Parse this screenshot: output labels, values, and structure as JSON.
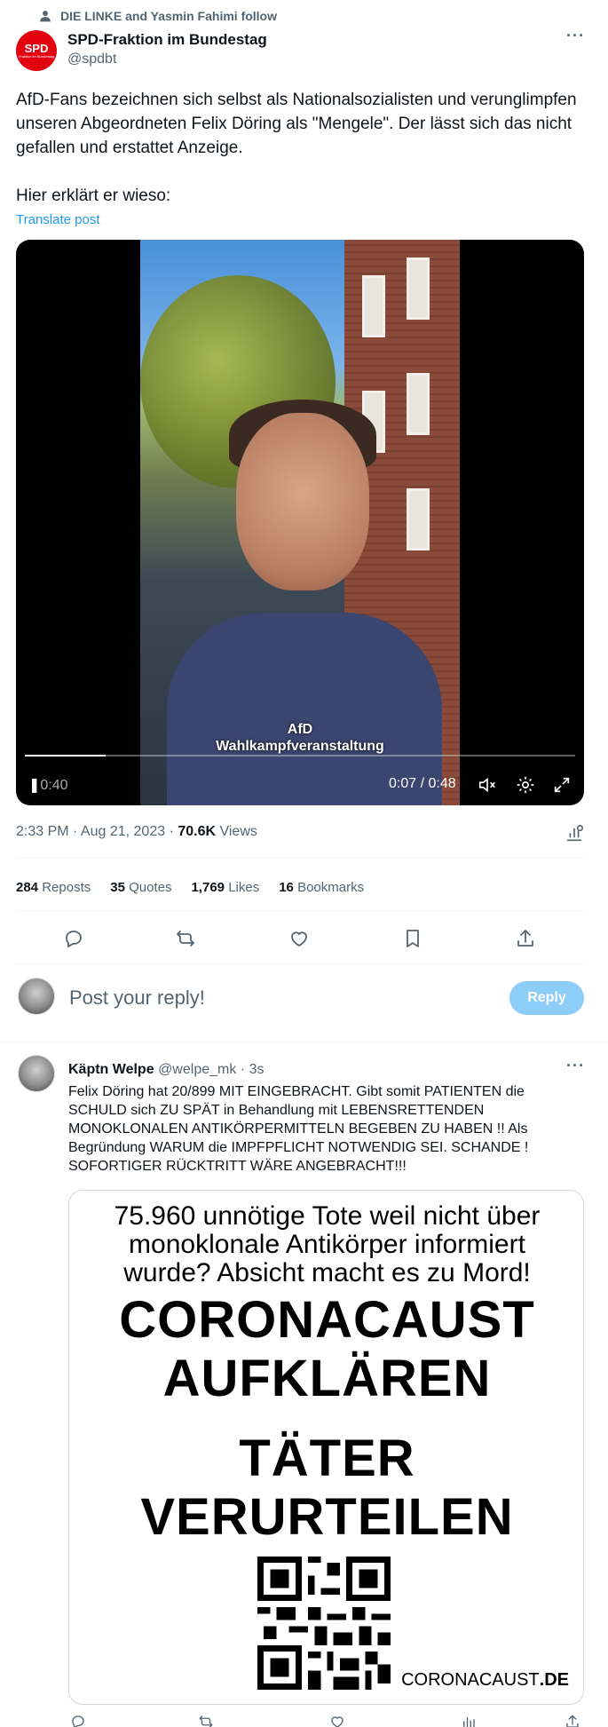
{
  "social_context": "DIE LINKE and Yasmin Fahimi follow",
  "author": {
    "name": "SPD-Fraktion im Bundestag",
    "handle": "@spdbt",
    "avatar_text": "SPD",
    "avatar_subtext": "Fraktion im Bundestag"
  },
  "tweet": {
    "text": "AfD-Fans bezeichnen sich selbst als Nationalsozialisten und verunglimpfen unseren Abgeordneten Felix Döring als \"Mengele\". Der lässt sich das nicht gefallen und erstattet Anzeige.\n\nHier erklärt er wieso:",
    "translate": "Translate post"
  },
  "video": {
    "caption_line1": "AfD",
    "caption_line2": "Wahlkampfveranstaltung",
    "left_time": "0:40",
    "time": "0:07 / 0:48",
    "progress": 0.146
  },
  "meta": {
    "time": "2:33 PM · Aug 21, 2023 · ",
    "views_count": "70.6K",
    "views_label": " Views"
  },
  "stats": {
    "reposts_count": "284",
    "reposts_label": "Reposts",
    "quotes_count": "35",
    "quotes_label": "Quotes",
    "likes_count": "1,769",
    "likes_label": "Likes",
    "bookmarks_count": "16",
    "bookmarks_label": "Bookmarks"
  },
  "compose": {
    "placeholder": "Post your reply!",
    "button": "Reply"
  },
  "reply": {
    "name": "Käptn Welpe",
    "handle": "@welpe_mk",
    "time": "· 3s",
    "text": "Felix Döring hat 20/899 MIT EINGEBRACHT. Gibt somit PATIENTEN die SCHULD sich ZU SPÄT in Behandlung mit LEBENSRETTENDEN MONOKLONALEN ANTIKÖRPERMITTELN BEGEBEN ZU HABEN !! Als Begründung WARUM die IMPFPFLICHT NOTWENDIG SEI. SCHANDE ! SOFORTIGER RÜCKTRITT WÄRE ANGEBRACHT!!!",
    "poster": {
      "line1": "75.960 unnötige Tote weil nicht über",
      "line2": "monoklonale Antikörper informiert",
      "line3": "wurde? Absicht macht es zu Mord!",
      "big1": "CORONACAUST",
      "big2": "AUFKLÄREN",
      "big3": "TÄTER",
      "big4": "VERURTEILEN",
      "site_main": "CORONACAUST",
      "site_tld": ".DE"
    }
  },
  "colors": {
    "accent": "#1d9bf0",
    "reply_button": "#8ecdf8",
    "spd_red": "#e3000f",
    "muted": "#536471"
  },
  "icons": [
    "person-icon",
    "more-icon",
    "mute-icon",
    "settings-icon",
    "fullscreen-icon",
    "reply-icon",
    "repost-icon",
    "like-icon",
    "bookmark-icon",
    "share-icon",
    "analytics-icon"
  ]
}
